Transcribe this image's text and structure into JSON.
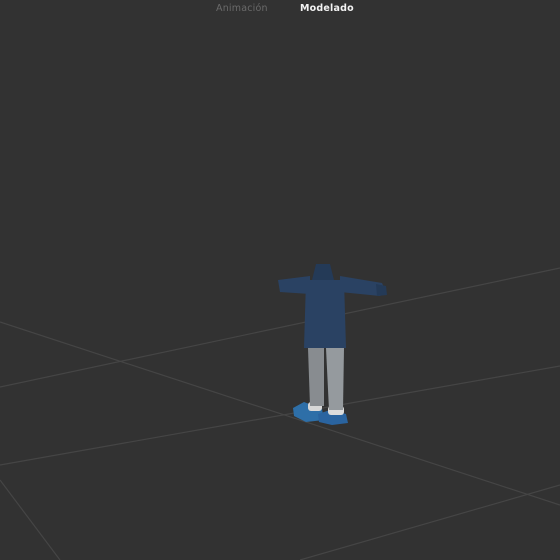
{
  "tabs": [
    {
      "label": "Animación",
      "active": false
    },
    {
      "label": "Modelado",
      "active": true
    }
  ],
  "colors": {
    "viewport_background": "#323232",
    "grid_line": "#454545",
    "tab_inactive": "#6a6a6a",
    "tab_active": "#f2f2f2",
    "sweater": "#2a4263",
    "pants": "#8e9296",
    "shoes": "#2e6fa8",
    "socks": "#d8d8d8"
  },
  "viewport": {
    "content": "3D character model in T-pose on ground grid",
    "icons": [
      "character-model"
    ]
  }
}
